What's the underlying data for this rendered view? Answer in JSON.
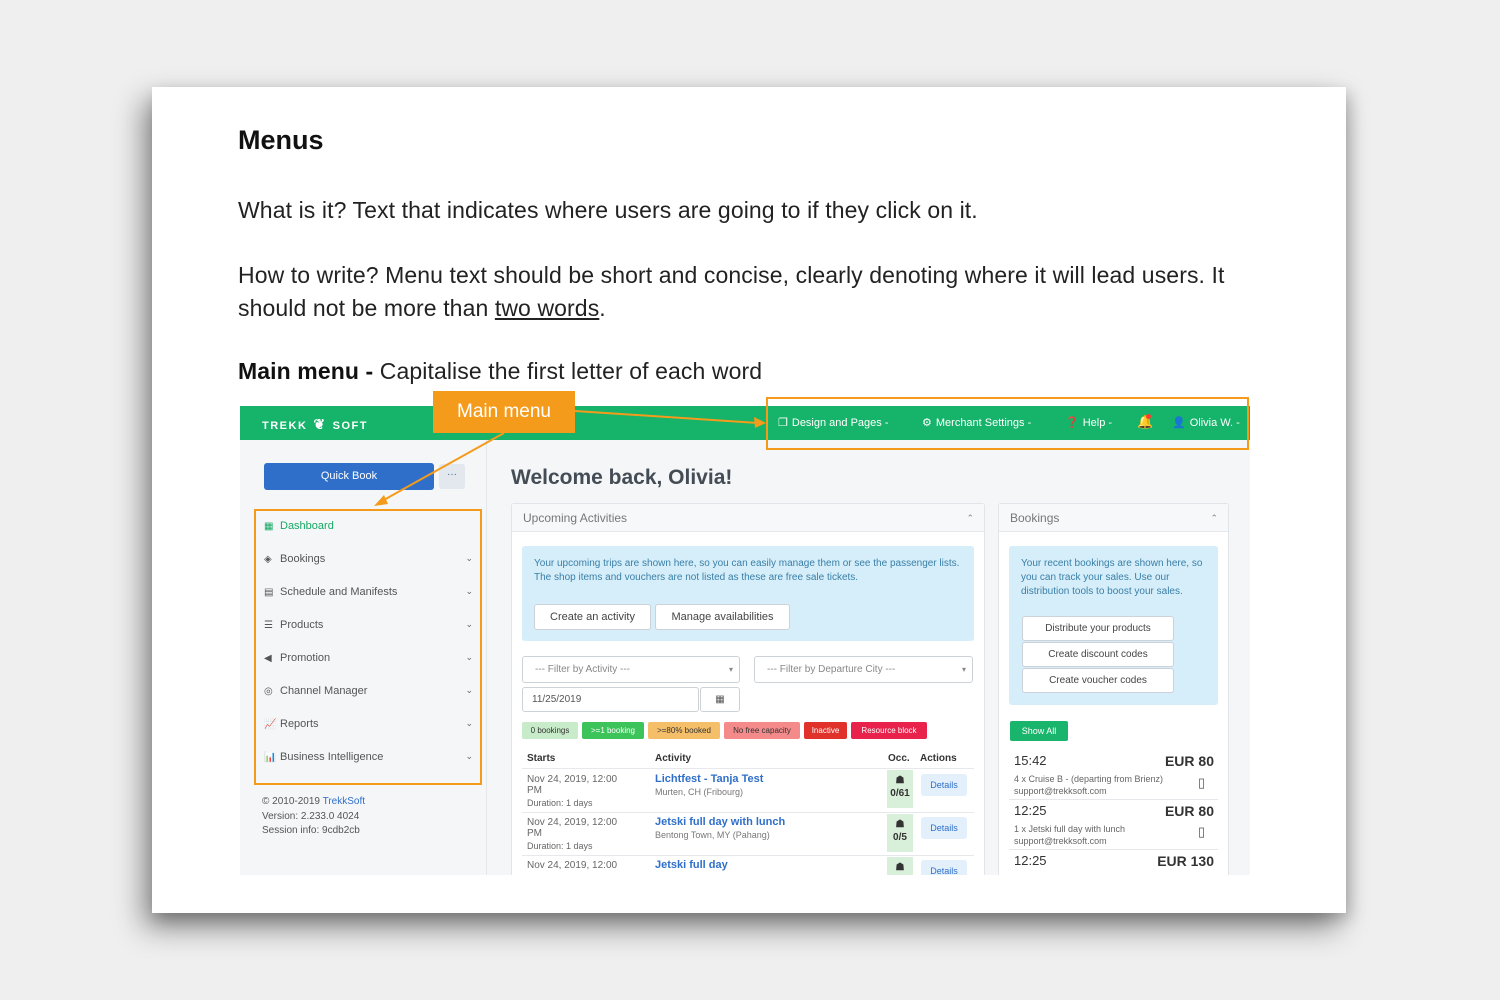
{
  "doc": {
    "heading": "Menus",
    "p1": "What is it? Text that indicates where users are going to if they click on it.",
    "p2_start": "How to write? Menu text should be short and concise, clearly denoting where it will lead users. It should not be more than ",
    "p2_underline": "two words",
    "p2_end": ".",
    "p3_bold": "Main menu - ",
    "p3_rest": "Capitalise the first letter of each word",
    "annotation_label": "Main menu"
  },
  "app": {
    "logo_left": "TREKK",
    "logo_right": "SOFT",
    "nav": [
      {
        "icon": "design-pages-icon",
        "label": "Design and Pages -"
      },
      {
        "icon": "gear-icon",
        "label": "Merchant Settings -"
      },
      {
        "icon": "help-icon",
        "label": "Help -"
      },
      {
        "icon": "bell-icon",
        "label": ""
      },
      {
        "icon": "user-icon",
        "label": "Olivia W. -"
      }
    ],
    "quick_book": "Quick Book",
    "more": "···",
    "menu": [
      {
        "icon": "dashboard-icon",
        "label": "Dashboard"
      },
      {
        "icon": "tag-icon",
        "label": "Bookings"
      },
      {
        "icon": "calendar-icon",
        "label": "Schedule and Manifests"
      },
      {
        "icon": "list-icon",
        "label": "Products"
      },
      {
        "icon": "megaphone-icon",
        "label": "Promotion"
      },
      {
        "icon": "globe-icon",
        "label": "Channel Manager"
      },
      {
        "icon": "line-chart-icon",
        "label": "Reports"
      },
      {
        "icon": "bar-chart-icon",
        "label": "Business Intelligence"
      }
    ],
    "footer": {
      "copyright": "© 2010-2019 ",
      "copyright_link": "TrekkSoft",
      "version": "Version: 2.233.0 4024",
      "session": "Session info: 9cdb2cb"
    },
    "welcome": "Welcome back, Olivia!",
    "upcoming": {
      "title": "Upcoming Activities",
      "info": "Your upcoming trips are shown here, so you can easily manage them or see the passenger lists. The shop items and vouchers are not listed as these are free sale tickets.",
      "btn_create": "Create an activity",
      "btn_manage": "Manage availabilities",
      "filter_activity": "--- Filter by Activity ---",
      "filter_city": "--- Filter by Departure City ---",
      "date": "11/25/2019",
      "tags": [
        {
          "label": "0 bookings",
          "color": "#c8ebc9"
        },
        {
          "label": ">=1 booking",
          "color": "#3cc45a"
        },
        {
          "label": ">=80% booked",
          "color": "#f5bf6a"
        },
        {
          "label": "No free capacity",
          "color": "#f48a8a"
        },
        {
          "label": "Inactive",
          "color": "#e0322a"
        },
        {
          "label": "Resource block",
          "color": "#e8224b"
        }
      ],
      "headers": {
        "starts": "Starts",
        "activity": "Activity",
        "occ": "Occ.",
        "actions": "Actions"
      },
      "rows": [
        {
          "start1": "Nov 24, 2019, 12:00",
          "start2": "PM",
          "duration": "Duration: 1 days",
          "activity": "Lichtfest - Tanja Test",
          "location": "Murten, CH (Fribourg)",
          "occ": "0/61",
          "action": "Details"
        },
        {
          "start1": "Nov 24, 2019, 12:00",
          "start2": "PM",
          "duration": "Duration: 1 days",
          "activity": "Jetski full day with lunch",
          "location": "Bentong Town, MY (Pahang)",
          "occ": "0/5",
          "action": "Details"
        },
        {
          "start1": "Nov 24, 2019, 12:00",
          "start2": "",
          "duration": "",
          "activity": "Jetski full day",
          "location": "",
          "occ": "",
          "action": "Details"
        }
      ]
    },
    "bookings": {
      "title": "Bookings",
      "info": "Your recent bookings are shown here, so you can track your sales. Use our distribution tools to boost your sales.",
      "btn_distribute": "Distribute your products",
      "btn_discount": "Create discount codes",
      "btn_voucher": "Create voucher codes",
      "show_all": "Show All",
      "items": [
        {
          "time": "15:42",
          "amount": "EUR 80",
          "desc": "4 x Cruise B - (departing from Brienz)",
          "email": "support@trekksoft.com"
        },
        {
          "time": "12:25",
          "amount": "EUR 80",
          "desc": "1 x Jetski full day with lunch",
          "email": "support@trekksoft.com"
        },
        {
          "time": "12:25",
          "amount": "EUR 130",
          "desc": "",
          "email": ""
        }
      ]
    }
  },
  "colors": {
    "accent": "#f59b1c",
    "brand_green": "#16b36a",
    "primary_blue": "#2f6fc9"
  }
}
